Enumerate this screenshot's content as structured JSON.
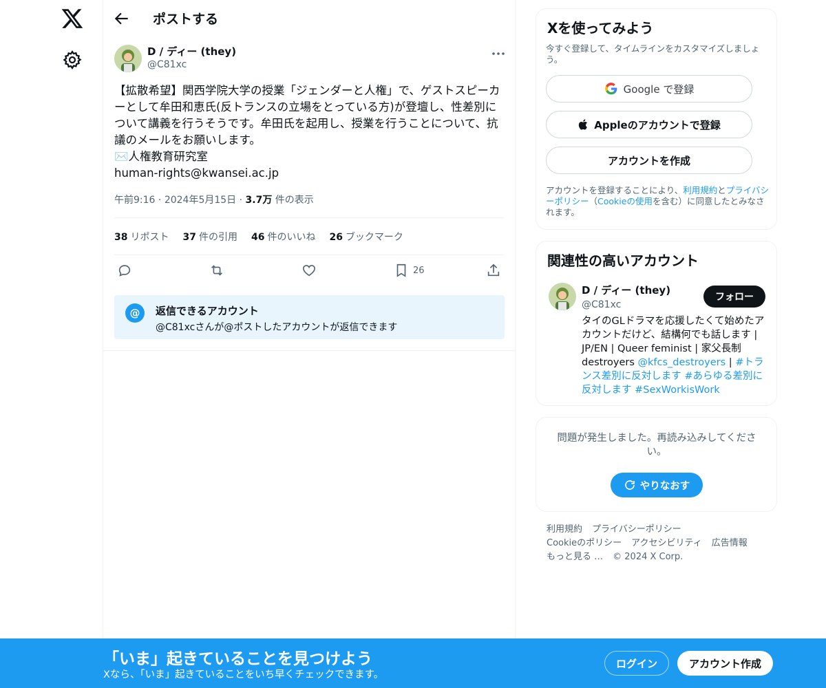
{
  "header": {
    "title": "ポストする"
  },
  "tweet": {
    "author_name": "D / ディー (they)",
    "author_handle": "@C81xc",
    "text": "【拡散希望】関西学院大学の授業「ジェンダーと人権」で、ゲストスピーカーとして牟田和恵氏(反トランスの立場をとっている方)が登壇し、性差別について講義を行うそうです。牟田氏を起用し、授業を行うことについて、抗議のメールをお願いします。\n✉️人権教育研究室\nhuman-rights@kwansei.ac.jp",
    "time": "午前9:16",
    "date": "2024年5月15日",
    "views_count": "3.7万",
    "views_label": "件の表示",
    "stats": [
      {
        "count": "38",
        "label": "リポスト"
      },
      {
        "count": "37",
        "label": "件の引用"
      },
      {
        "count": "46",
        "label": "件のいいね"
      },
      {
        "count": "26",
        "label": "ブックマーク"
      }
    ],
    "bookmark_count": "26"
  },
  "reply_restriction": {
    "icon": "@",
    "title": "返信できるアカウント",
    "subtitle": "@C81xcさんが@ポストしたアカウントが返信できます"
  },
  "signup_card": {
    "title": "Xを使ってみよう",
    "subtitle": "今すぐ登録して、タイムラインをカスタマイズしましょう。",
    "google_label": "Google で登録",
    "apple_label": "Appleのアカウントで登録",
    "create_label": "アカウントを作成",
    "legal_prefix": "アカウントを登録することにより、",
    "terms": "利用規約",
    "and": "と",
    "privacy": "プライバシーポリシー",
    "open_paren": "（",
    "cookie": "Cookieの使用",
    "legal_suffix": "を含む）に同意したとみなされます。"
  },
  "related": {
    "title": "関連性の高いアカウント",
    "name": "D / ディー (they)",
    "handle": "@C81xc",
    "follow_label": "フォロー",
    "bio_text": "タイのGLドラマを応援したくて始めたアカウントだけど、結構何でも話します | JP/EN | Queer feminist | 家父長制destroyers ",
    "bio_mention": "@kfcs_destroyers",
    "bio_sep": " | ",
    "bio_tags": "#トランス差別に反対します #あらゆる差別に反対します #SexWorkisWork"
  },
  "error_card": {
    "message": "問題が発生しました。再読み込みしてください。",
    "retry_label": "やりなおす"
  },
  "footer": {
    "terms": "利用規約",
    "privacy": "プライバシーポリシー",
    "cookie": "Cookieのポリシー",
    "accessibility": "アクセシビリティ",
    "ads": "広告情報",
    "more": "もっと見る …",
    "copyright": "© 2024 X Corp."
  },
  "banner": {
    "title": "「いま」起きていることを見つけよう",
    "subtitle": "Xなら、「いま」起きていることをいち早くチェックできます。",
    "login_label": "ログイン",
    "signup_label": "アカウント作成"
  },
  "colors": {
    "accent": "#1d9bf0",
    "text": "#0f1419",
    "muted": "#536471"
  }
}
